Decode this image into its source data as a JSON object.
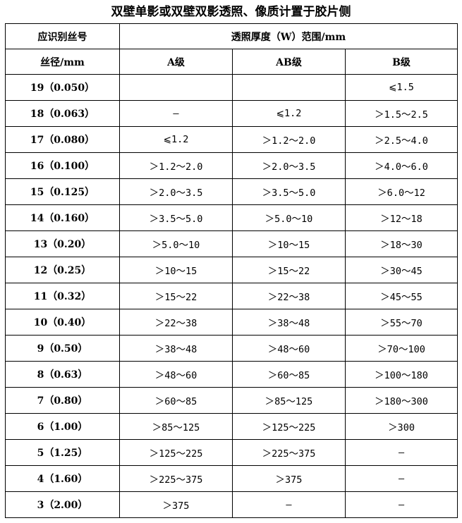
{
  "title": "双壁单影或双壁双影透照、像质计置于胶片侧",
  "header": {
    "col1_line1": "应识别丝号",
    "col1_line2": "丝径/mm",
    "thickness_header": "透照厚度（W）范围/mm",
    "grade_a": "A级",
    "grade_ab": "AB级",
    "grade_b": "B级"
  },
  "rows": [
    {
      "wire": "19（0.050）",
      "a": "",
      "ab": "",
      "b": "⩽1.5"
    },
    {
      "wire": "18（0.063）",
      "a": "–",
      "ab": "⩽1.2",
      "b": "＞1.5～2.5"
    },
    {
      "wire": "17（0.080）",
      "a": "⩽1.2",
      "ab": "＞1.2～2.0",
      "b": "＞2.5～4.0"
    },
    {
      "wire": "16（0.100）",
      "a": "＞1.2～2.0",
      "ab": "＞2.0～3.5",
      "b": "＞4.0～6.0"
    },
    {
      "wire": "15（0.125）",
      "a": "＞2.0～3.5",
      "ab": "＞3.5～5.0",
      "b": "＞6.0～12"
    },
    {
      "wire": "14（0.160）",
      "a": "＞3.5～5.0",
      "ab": "＞5.0～10",
      "b": "＞12～18"
    },
    {
      "wire": "13（0.20）",
      "a": "＞5.0～10",
      "ab": "＞10～15",
      "b": "＞18～30"
    },
    {
      "wire": "12（0.25）",
      "a": "＞10～15",
      "ab": "＞15～22",
      "b": "＞30～45"
    },
    {
      "wire": "11（0.32）",
      "a": "＞15～22",
      "ab": "＞22～38",
      "b": "＞45～55"
    },
    {
      "wire": "10（0.40）",
      "a": "＞22～38",
      "ab": "＞38～48",
      "b": "＞55～70"
    },
    {
      "wire": "9（0.50）",
      "a": "＞38～48",
      "ab": "＞48～60",
      "b": "＞70～100"
    },
    {
      "wire": "8（0.63）",
      "a": "＞48～60",
      "ab": "＞60～85",
      "b": "＞100～180"
    },
    {
      "wire": "7（0.80）",
      "a": "＞60～85",
      "ab": "＞85～125",
      "b": "＞180～300"
    },
    {
      "wire": "6（1.00）",
      "a": "＞85～125",
      "ab": "＞125～225",
      "b": "＞300"
    },
    {
      "wire": "5（1.25）",
      "a": "＞125～225",
      "ab": "＞225～375",
      "b": "–"
    },
    {
      "wire": "4（1.60）",
      "a": "＞225～375",
      "ab": "＞375",
      "b": "–"
    },
    {
      "wire": "3（2.00）",
      "a": "＞375",
      "ab": "–",
      "b": "–"
    }
  ]
}
